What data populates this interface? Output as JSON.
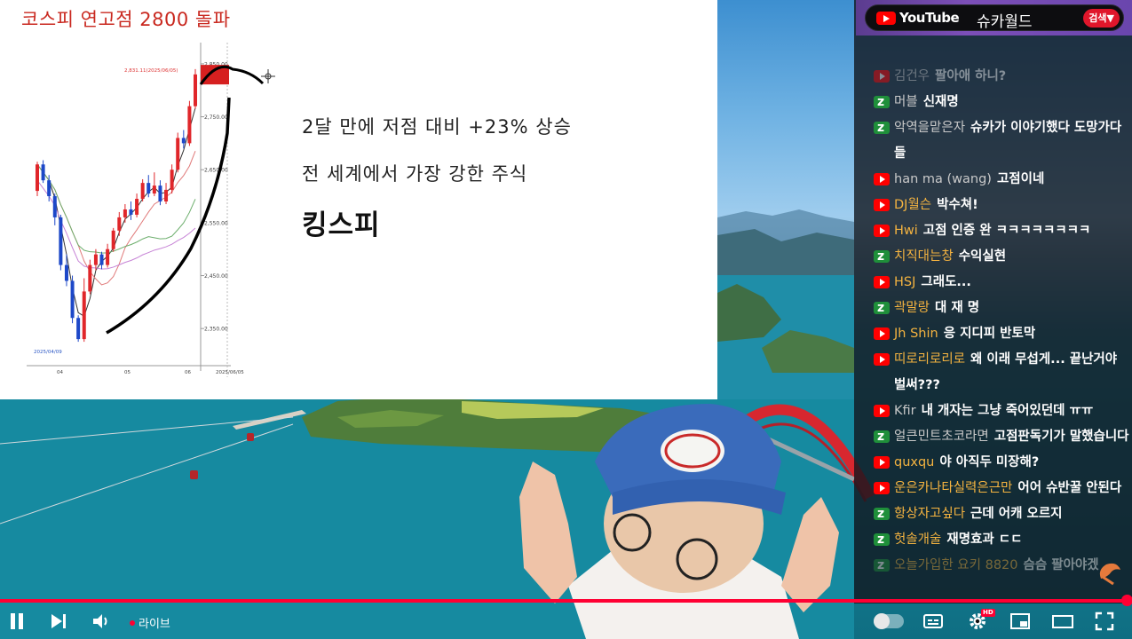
{
  "slide": {
    "title": "코스피 연고점 2800 돌파",
    "line1": "2달 만에 저점 대비 +23% 상승",
    "line2": "전 세계에서 가장 강한 주식",
    "line3": "킹스피"
  },
  "chart_data": {
    "type": "candlestick",
    "price_ticks": [
      "2,850.00",
      "2,750.00",
      "2,650.00",
      "2,550.00",
      "2,450.00",
      "2,350.00"
    ],
    "high_label": "2,831.11(2025/06/05)",
    "low_label": "2025/04/09",
    "x_ticks": [
      "04",
      "05",
      "06",
      "2025/06/05"
    ],
    "ylim": [
      2300,
      2870
    ],
    "candles": [
      {
        "o": 2610,
        "c": 2660,
        "h": 2665,
        "l": 2600
      },
      {
        "o": 2660,
        "c": 2630,
        "h": 2668,
        "l": 2625
      },
      {
        "o": 2630,
        "c": 2600,
        "h": 2640,
        "l": 2590
      },
      {
        "o": 2600,
        "c": 2560,
        "h": 2605,
        "l": 2545
      },
      {
        "o": 2560,
        "c": 2470,
        "h": 2565,
        "l": 2460
      },
      {
        "o": 2470,
        "c": 2440,
        "h": 2490,
        "l": 2430
      },
      {
        "o": 2440,
        "c": 2370,
        "h": 2450,
        "l": 2360
      },
      {
        "o": 2370,
        "c": 2330,
        "h": 2375,
        "l": 2325
      },
      {
        "o": 2330,
        "c": 2420,
        "h": 2445,
        "l": 2325
      },
      {
        "o": 2420,
        "c": 2470,
        "h": 2480,
        "l": 2415
      },
      {
        "o": 2470,
        "c": 2490,
        "h": 2500,
        "l": 2460
      },
      {
        "o": 2490,
        "c": 2470,
        "h": 2495,
        "l": 2462
      },
      {
        "o": 2470,
        "c": 2500,
        "h": 2510,
        "l": 2465
      },
      {
        "o": 2500,
        "c": 2535,
        "h": 2540,
        "l": 2495
      },
      {
        "o": 2535,
        "c": 2560,
        "h": 2570,
        "l": 2525
      },
      {
        "o": 2560,
        "c": 2575,
        "h": 2585,
        "l": 2550
      },
      {
        "o": 2575,
        "c": 2565,
        "h": 2590,
        "l": 2555
      },
      {
        "o": 2565,
        "c": 2595,
        "h": 2605,
        "l": 2560
      },
      {
        "o": 2595,
        "c": 2625,
        "h": 2632,
        "l": 2590
      },
      {
        "o": 2625,
        "c": 2605,
        "h": 2640,
        "l": 2598
      },
      {
        "o": 2605,
        "c": 2620,
        "h": 2645,
        "l": 2600
      },
      {
        "o": 2620,
        "c": 2590,
        "h": 2630,
        "l": 2583
      },
      {
        "o": 2590,
        "c": 2612,
        "h": 2625,
        "l": 2585
      },
      {
        "o": 2612,
        "c": 2650,
        "h": 2660,
        "l": 2605
      },
      {
        "o": 2650,
        "c": 2710,
        "h": 2720,
        "l": 2645
      },
      {
        "o": 2710,
        "c": 2700,
        "h": 2725,
        "l": 2690
      },
      {
        "o": 2700,
        "c": 2770,
        "h": 2780,
        "l": 2695
      },
      {
        "o": 2770,
        "c": 2830,
        "h": 2840,
        "l": 2765
      }
    ]
  },
  "chat": {
    "header": {
      "logo_text": "YouTube",
      "channel": "슈카월드",
      "search_label": "검색▼"
    },
    "messages": [
      {
        "badge": "yt",
        "author": "김건우",
        "author_color": "#c9c9c9",
        "text": "팔아애 하니?",
        "faded": true
      },
      {
        "badge": "z",
        "author": "머블",
        "author_color": "#c9c9c9",
        "text": "신재명"
      },
      {
        "badge": "z",
        "author": "악역을맡은자",
        "author_color": "#c9c9c9",
        "text": "슈카가 이야기했다 도망가다들",
        "wrap": true
      },
      {
        "badge": "yt",
        "author": "han ma (wang)",
        "author_color": "#c9c9c9",
        "text": "고점이네"
      },
      {
        "badge": "yt",
        "author": "DJ월슨",
        "author_color": "#f4b340",
        "text": "박수쳐!"
      },
      {
        "badge": "yt",
        "author": "Hwi",
        "author_color": "#f4b340",
        "text": "고점 인증 완 ㅋㅋㅋㅋㅋㅋㅋㅋ"
      },
      {
        "badge": "z",
        "author": "치직대는창",
        "author_color": "#f4b340",
        "text": "수익실현"
      },
      {
        "badge": "yt",
        "author": "HSJ",
        "author_color": "#f4b340",
        "text": "그래도..."
      },
      {
        "badge": "z",
        "author": "곽말랑",
        "author_color": "#f4b340",
        "text": "대 재 명"
      },
      {
        "badge": "yt",
        "author": "Jh Shin",
        "author_color": "#f4b340",
        "text": "응 지디피 반토막"
      },
      {
        "badge": "yt",
        "author": "띠로리로리로",
        "author_color": "#f4b340",
        "text": "왜 이래 무섭게... 끝난거야 벌써???",
        "wrap": true
      },
      {
        "badge": "yt",
        "author": "Kfir",
        "author_color": "#c9c9c9",
        "text": "내 개자는 그냥 죽어있던데 ㅠㅠ"
      },
      {
        "badge": "z",
        "author": "얼큰민트초코라면",
        "author_color": "#c9c9c9",
        "text": "고점판독기가 말했습니다",
        "wrap": true
      },
      {
        "badge": "yt",
        "author": "quxqu",
        "author_color": "#f4b340",
        "text": "야 아직두 미장해?"
      },
      {
        "badge": "yt",
        "author": "운은카나타실력은근만",
        "author_color": "#f4b340",
        "text": "어어 슈반꿀 안된다",
        "wrap": true
      },
      {
        "badge": "z",
        "author": "항상자고싶다",
        "author_color": "#f4b340",
        "text": "근데 어캐 오르지"
      },
      {
        "badge": "z",
        "author": "헛솔개술",
        "author_color": "#f4b340",
        "text": "재명효과 ㄷㄷ"
      },
      {
        "badge": "z",
        "author": "오늘가입한 요키 8820",
        "author_color": "#f4b340",
        "text": "슴슴 팔아야겠",
        "faded": true
      }
    ]
  },
  "player": {
    "progress": 0.995,
    "live_label": "라이브",
    "hd_label": "HD"
  }
}
